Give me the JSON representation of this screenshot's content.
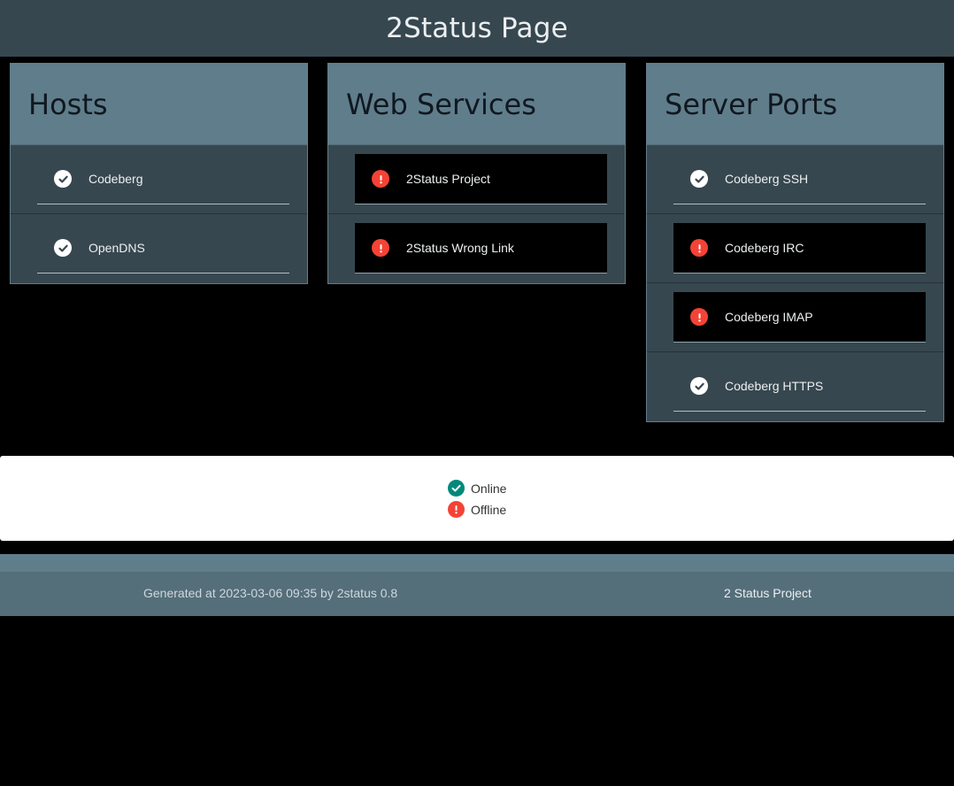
{
  "header": {
    "title": "2Status Page"
  },
  "groups": [
    {
      "title": "Hosts",
      "items": [
        {
          "label": "Codeberg",
          "status": "online"
        },
        {
          "label": "OpenDNS",
          "status": "online"
        }
      ]
    },
    {
      "title": "Web Services",
      "items": [
        {
          "label": "2Status Project",
          "status": "offline"
        },
        {
          "label": "2Status Wrong Link",
          "status": "offline"
        }
      ]
    },
    {
      "title": "Server Ports",
      "items": [
        {
          "label": "Codeberg SSH",
          "status": "online"
        },
        {
          "label": "Codeberg IRC",
          "status": "offline"
        },
        {
          "label": "Codeberg IMAP",
          "status": "offline"
        },
        {
          "label": "Codeberg HTTPS",
          "status": "online"
        }
      ]
    }
  ],
  "legend": {
    "online_label": "Online",
    "offline_label": "Offline"
  },
  "footer": {
    "generated": "Generated at 2023-03-06 09:35 by 2status 0.8",
    "project_link": "2 Status Project"
  },
  "colors": {
    "header_bg": "#37474f",
    "card_header_bg": "#607d8b",
    "online": "#00897b",
    "offline": "#f44336"
  },
  "icons": {
    "online": "check-circle-icon",
    "offline": "exclamation-circle-icon"
  }
}
